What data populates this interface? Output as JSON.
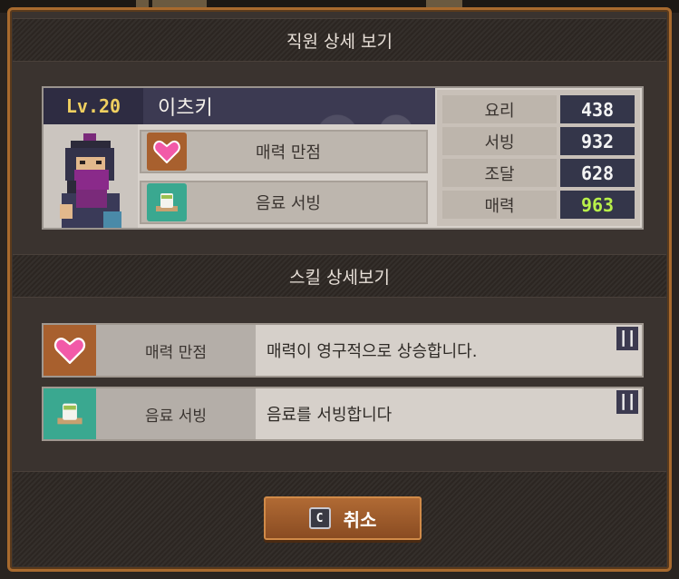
{
  "dialog": {
    "title": "직원 상세 보기",
    "skills_title": "스킬 상세보기"
  },
  "employee": {
    "level": "Lv.20",
    "name": "이츠키",
    "traits": [
      {
        "label": "매력 만점",
        "icon": "heart-icon"
      },
      {
        "label": "음료 서빙",
        "icon": "tea-cup-icon"
      }
    ],
    "stats": [
      {
        "name": "요리",
        "value": "438",
        "color": "#f4f4f4"
      },
      {
        "name": "서빙",
        "value": "932",
        "color": "#f4f4f4"
      },
      {
        "name": "조달",
        "value": "628",
        "color": "#f4f4f4"
      },
      {
        "name": "매력",
        "value": "963",
        "color": "#b8f04a"
      }
    ]
  },
  "skills": [
    {
      "name": "매력 만점",
      "description": "매력이 영구적으로 상승합니다.",
      "icon": "heart-icon",
      "icon_bg": "#a8602e"
    },
    {
      "name": "음료 서빙",
      "description": "음료를 서빙합니다",
      "icon": "tea-cup-icon",
      "icon_bg": "#3aa890"
    }
  ],
  "footer": {
    "cancel_key": "C",
    "cancel_label": "취소"
  }
}
